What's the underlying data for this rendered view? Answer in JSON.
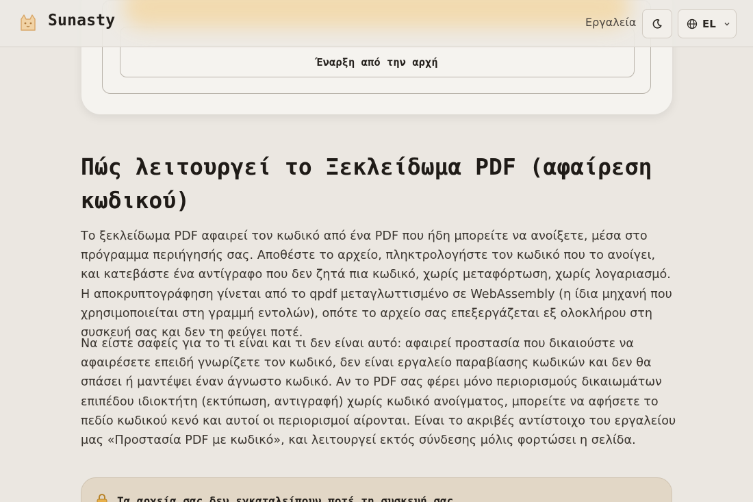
{
  "header": {
    "brand": "Sunasty",
    "nav_tools_label": "Εργαλεία",
    "language_code": "EL"
  },
  "card": {
    "restart_label": "Έναρξη από την αρχή"
  },
  "article": {
    "heading": "Πώς λειτουργεί το Ξεκλείδωμα PDF (αφαίρεση κωδικού)",
    "paragraphs": [
      "Το ξεκλείδωμα PDF αφαιρεί τον κωδικό από ένα PDF που ήδη μπορείτε να ανοίξετε, μέσα στο πρόγραμμα περιήγησής σας. Αποθέστε το αρχείο, πληκτρολογήστε τον κωδικό που το ανοίγει, και κατεβάστε ένα αντίγραφο που δεν ζητά πια κωδικό, χωρίς μεταφόρτωση, χωρίς λογαριασμό. Η αποκρυπτογράφηση γίνεται από το qpdf μεταγλωττισμένο σε WebAssembly (η ίδια μηχανή που χρησιμοποιείται στη γραμμή εντολών), οπότε το αρχείο σας επεξεργάζεται εξ ολοκλήρου στη συσκευή σας και δεν τη φεύγει ποτέ.",
      "Να είστε σαφείς για το τι είναι και τι δεν είναι αυτό: αφαιρεί προστασία που δικαιούστε να αφαιρέσετε επειδή γνωρίζετε τον κωδικό, δεν είναι εργαλείο παραβίασης κωδικών και δεν θα σπάσει ή μαντέψει έναν άγνωστο κωδικό. Αν το PDF σας φέρει μόνο περιορισμούς δικαιωμάτων επιπέδου ιδιοκτήτη (εκτύπωση, αντιγραφή) χωρίς κωδικό ανοίγματος, μπορείτε να αφήσετε το πεδίο κωδικού κενό και αυτοί οι περιορισμοί αίρονται. Είναι το ακριβές αντίστοιχο του εργαλείου μας «Προστασία PDF με κωδικό», και λειτουργεί εκτός σύνδεσης μόλις φορτώσει η σελίδα."
    ]
  },
  "note": {
    "text": "Τα αρχεία σας δεν εγκαταλείπουν ποτέ τη συσκευή σας"
  },
  "colors": {
    "background": "#ebe7e1",
    "card": "#f5f3ef",
    "note_bg": "#e2d7c6",
    "accent_glow": "#f3d8a6"
  },
  "icons": [
    "cat-logo-icon",
    "moon-icon",
    "globe-icon",
    "chevron-down-icon",
    "lock-icon"
  ]
}
